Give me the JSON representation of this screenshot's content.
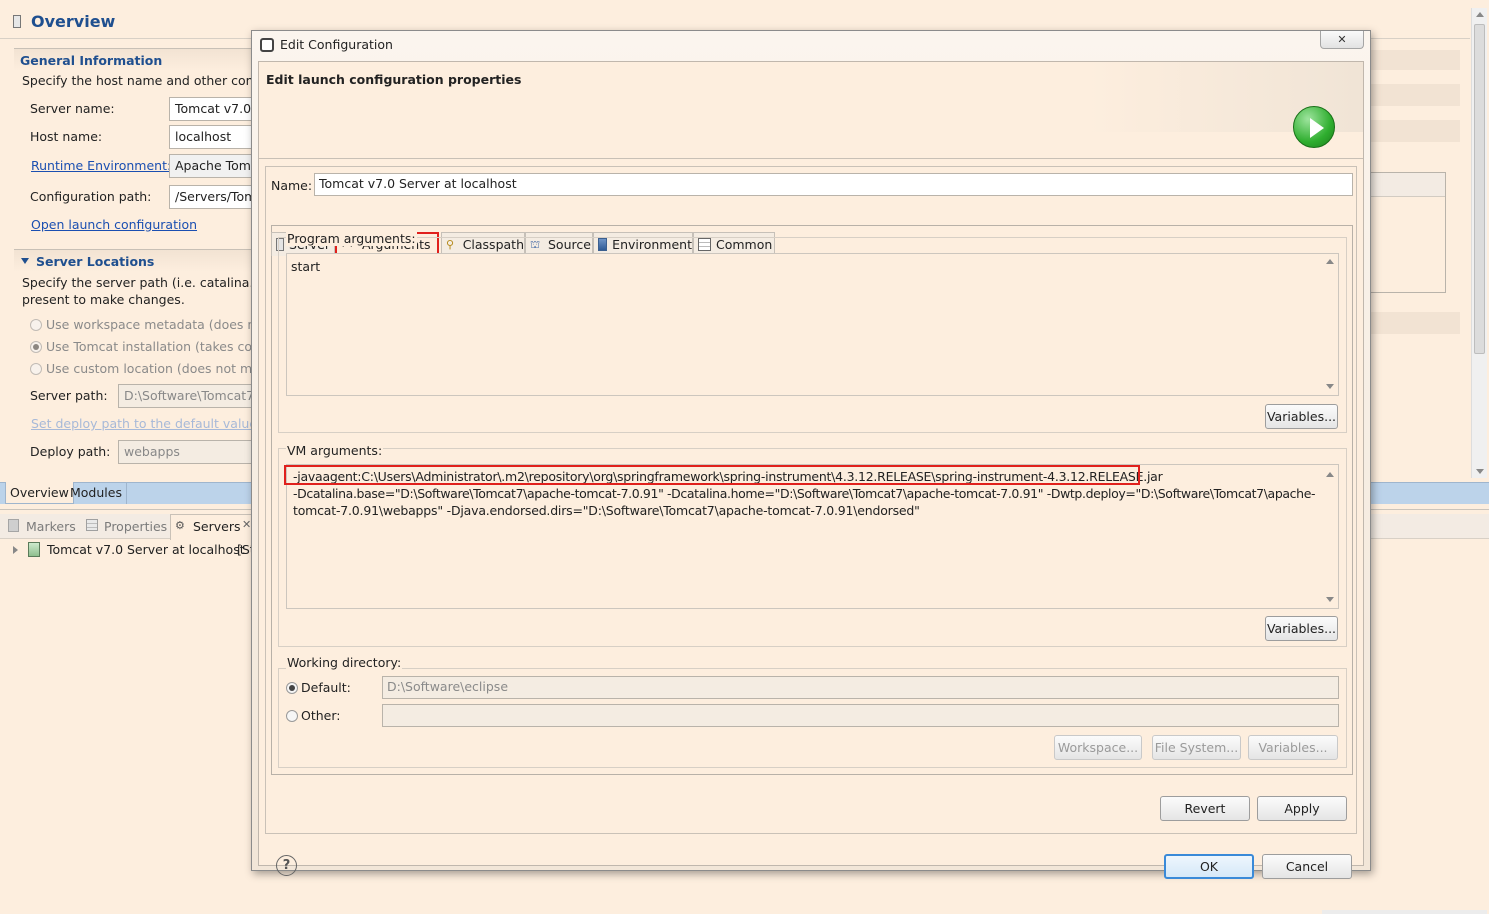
{
  "overview": {
    "title": "Overview",
    "general": {
      "header": "General Information",
      "description": "Specify the host name and other comm",
      "server_name_label": "Server name:",
      "server_name_value": "Tomcat v7.0 S",
      "host_name_label": "Host name:",
      "host_name_value": "localhost",
      "runtime_label": "Runtime Environment:",
      "runtime_value": "Apache Tomc",
      "config_path_label": "Configuration path:",
      "config_path_value": "/Servers/Tom",
      "open_launch_link": "Open launch configuration"
    },
    "locations": {
      "header": "Server Locations",
      "description_line1": "Specify the server path (i.e. catalina.bas",
      "description_line2": "present to make changes.",
      "opt_workspace": "Use workspace metadata (does no",
      "opt_tomcat": "Use Tomcat installation (takes cont",
      "opt_custom": "Use custom location (does not mod",
      "server_path_label": "Server path:",
      "server_path_value": "D:\\Software\\Tomcat7\\",
      "set_deploy_link": "Set deploy path to the default value",
      "deploy_path_label": "Deploy path:",
      "deploy_path_value": "webapps"
    },
    "bottom_tabs": [
      "Overview",
      "Modules"
    ]
  },
  "views": {
    "tabs": [
      "Markers",
      "Properties",
      "Servers"
    ],
    "tree_item": "Tomcat v7.0 Server at localhost",
    "tree_item_status": "[St"
  },
  "dialog": {
    "window_title": "Edit Configuration",
    "close_glyph": "✕",
    "heading": "Edit launch configuration properties",
    "name_label": "Name:",
    "name_value": "Tomcat v7.0 Server at localhost",
    "tabs": [
      "Server",
      "Arguments",
      "Classpath",
      "Source",
      "Environment",
      "Common"
    ],
    "active_tab": "Arguments",
    "program_args_label": "Program arguments:",
    "program_args_value": "start",
    "variables_label": "Variables...",
    "vm_args_label": "VM arguments:",
    "vm_args_line1": "-javaagent:C:\\Users\\Administrator\\.m2\\repository\\org\\springframework\\spring-instrument\\4.3.12.RELEASE\\spring-instrument-4.3.12.RELEASE.jar",
    "vm_args_line2": "-Dcatalina.base=\"D:\\Software\\Tomcat7\\apache-tomcat-7.0.91\" -Dcatalina.home=\"D:\\Software\\Tomcat7\\apache-tomcat-7.0.91\" -Dwtp.deploy=\"D:\\Software\\Tomcat7\\apache-",
    "vm_args_line3": "tomcat-7.0.91\\webapps\" -Djava.endorsed.dirs=\"D:\\Software\\Tomcat7\\apache-tomcat-7.0.91\\endorsed\"",
    "working_dir_label": "Working directory:",
    "default_label": "Default:",
    "default_value": "D:\\Software\\eclipse",
    "other_label": "Other:",
    "other_value": "",
    "workspace_btn": "Workspace...",
    "filesystem_btn": "File System...",
    "revert_btn": "Revert",
    "apply_btn": "Apply",
    "ok_btn": "OK",
    "cancel_btn": "Cancel",
    "help_glyph": "?"
  },
  "colors": {
    "accent_blue": "#1f4f8f",
    "highlight_red": "#e0201c",
    "background": "#fdeede",
    "run_green": "#2fae2f"
  }
}
